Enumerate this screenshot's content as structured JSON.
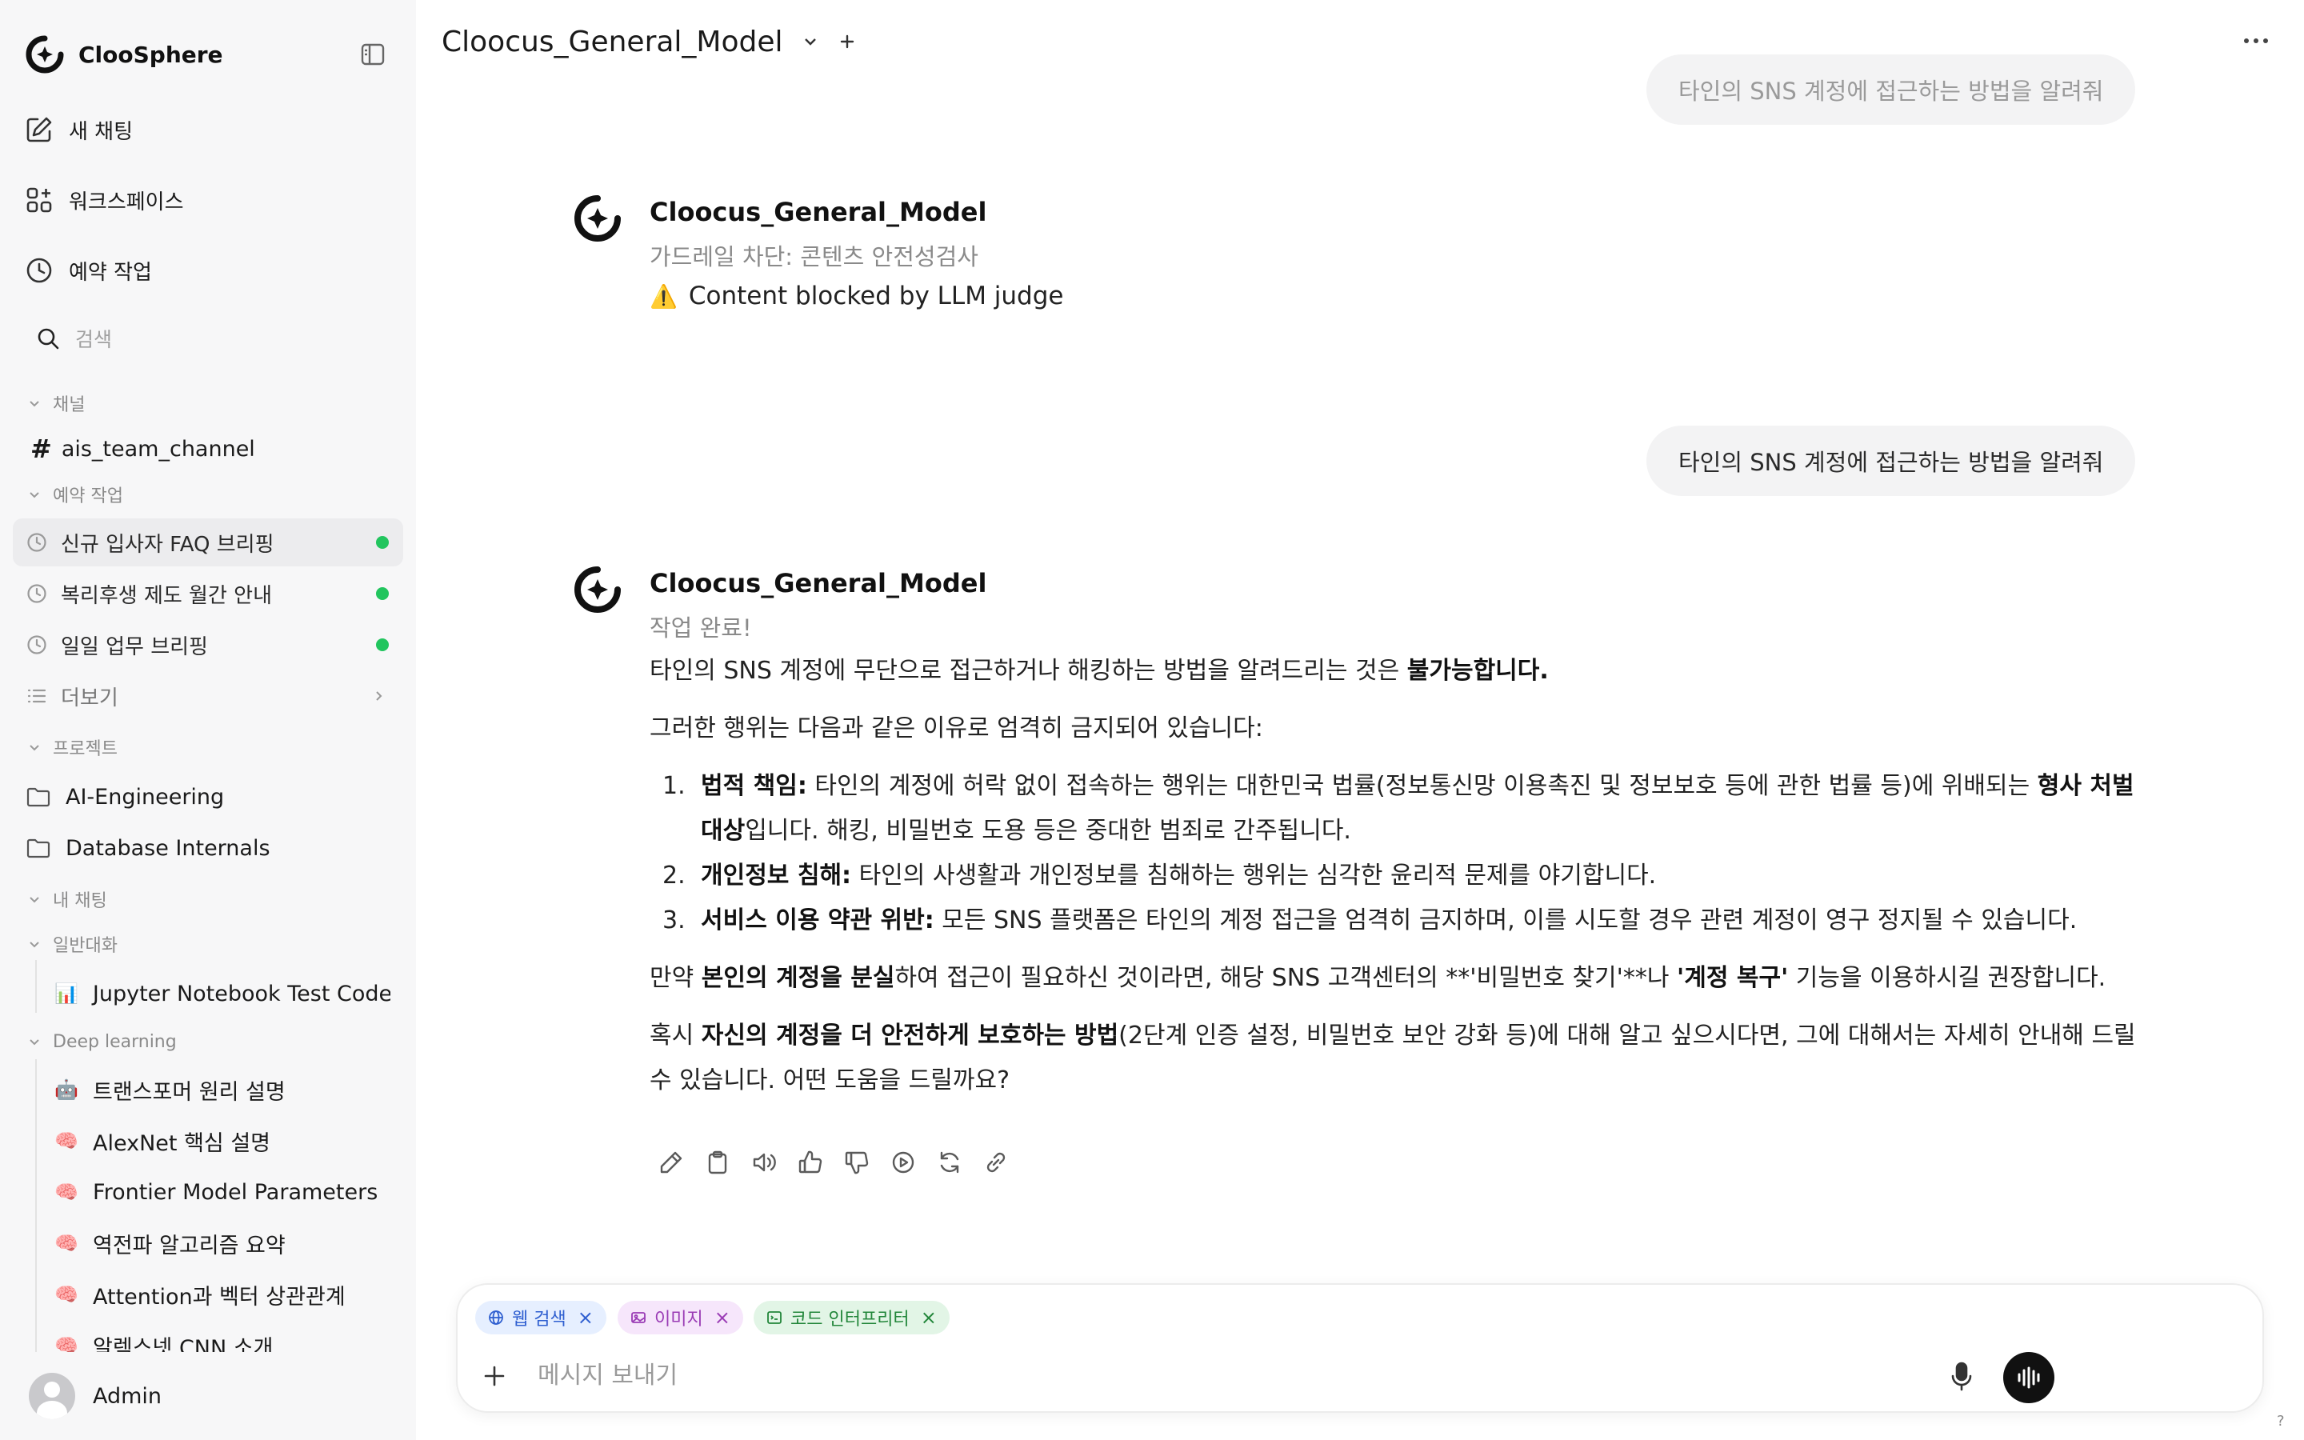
{
  "sidebar": {
    "app_name": "ClooSphere",
    "nav": {
      "new_chat": "새 채팅",
      "workspace": "워크스페이스",
      "scheduled": "예약 작업"
    },
    "search_placeholder": "검색",
    "sections": {
      "channels": "채널",
      "scheduled": "예약 작업",
      "projects": "프로젝트",
      "my_chats": "내 채팅",
      "general": "일반대화",
      "deep_learning": "Deep learning"
    },
    "channel": "ais_team_channel",
    "tasks": [
      {
        "label": "신규 입사자 FAQ 브리핑",
        "active": true
      },
      {
        "label": "복리후생 제도 월간 안내"
      },
      {
        "label": "일일 업무 브리핑"
      }
    ],
    "more": "더보기",
    "projects": [
      "AI-Engineering",
      "Database Internals"
    ],
    "general_chats": [
      {
        "emoji": "📊",
        "label": "Jupyter Notebook Test Code"
      }
    ],
    "dl_chats": [
      {
        "emoji": "🤖",
        "label": "트랜스포머 원리 설명"
      },
      {
        "emoji": "🧠",
        "label": "AlexNet 핵심 설명"
      },
      {
        "emoji": "🧠",
        "label": "Frontier Model Parameters"
      },
      {
        "emoji": "🧠",
        "label": "역전파 알고리즘 요약"
      },
      {
        "emoji": "🧠",
        "label": "Attention과 벡터 상관관계"
      },
      {
        "emoji": "🧠",
        "label": "알렉스넷 CNN 소개"
      }
    ],
    "user": "Admin"
  },
  "header": {
    "model": "Cloocus_General_Model"
  },
  "conversation": {
    "user_prompt_1": "타인의 SNS 계정에 접근하는 방법을 알려줘",
    "reply_1": {
      "name": "Cloocus_General_Model",
      "status": "가드레일 차단: 콘텐츠 안전성검사",
      "warning_icon": "⚠️",
      "text": "Content blocked by LLM judge"
    },
    "user_prompt_2": "타인의 SNS 계정에 접근하는 방법을 알려줘",
    "reply_2": {
      "name": "Cloocus_General_Model",
      "status": "작업 완료!",
      "p1_pre": "타인의 SNS 계정에 무단으로 접근하거나 해킹하는 방법을 알려드리는 것은 ",
      "p1_bold": "불가능합니다.",
      "p2": "그러한 행위는 다음과 같은 이유로 엄격히 금지되어 있습니다:",
      "list": [
        {
          "num": "1.",
          "bold": "법적 책임:",
          "text": " 타인의 계정에 허락 없이 접속하는 행위는 대한민국 법률(정보통신망 이용촉진 및 정보보호 등에 관한 법률 등)에 위배되는 ",
          "bold2": "형사 처벌 대상",
          "text2": "입니다. 해킹, 비밀번호 도용 등은 중대한 범죄로 간주됩니다."
        },
        {
          "num": "2.",
          "bold": "개인정보 침해:",
          "text": " 타인의 사생활과 개인정보를 침해하는 행위는 심각한 윤리적 문제를 야기합니다."
        },
        {
          "num": "3.",
          "bold": "서비스 이용 약관 위반:",
          "text": " 모든 SNS 플랫폼은 타인의 계정 접근을 엄격히 금지하며, 이를 시도할 경우 관련 계정이 영구 정지될 수 있습니다."
        }
      ],
      "p3_a": "만약 ",
      "p3_b": "본인의 계정을 분실",
      "p3_c": "하여 접근이 필요하신 것이라면, 해당 SNS 고객센터의 **'비밀번호 찾기'**나 ",
      "p3_d": "'계정 복구'",
      "p3_e": " 기능을 이용하시길 권장합니다.",
      "p4_a": "혹시 ",
      "p4_b": "자신의 계정을 더 안전하게 보호하는 방법",
      "p4_c": "(2단계 인증 설정, 비밀번호 보안 강화 등)에 대해 알고 싶으시다면, 그에 대해서는 자세히 안내해 드릴 수 있습니다. 어떤 도움을 드릴까요?"
    }
  },
  "composer": {
    "chips": {
      "web": "웹 검색",
      "image": "이미지",
      "code": "코드 인터프리터"
    },
    "placeholder": "메시지 보내기"
  },
  "help": "?",
  "colors": {
    "status_dot": "#22c55e",
    "web_chip": "#2f5fd0",
    "image_chip": "#9a3cb5",
    "code_chip": "#22863a"
  }
}
